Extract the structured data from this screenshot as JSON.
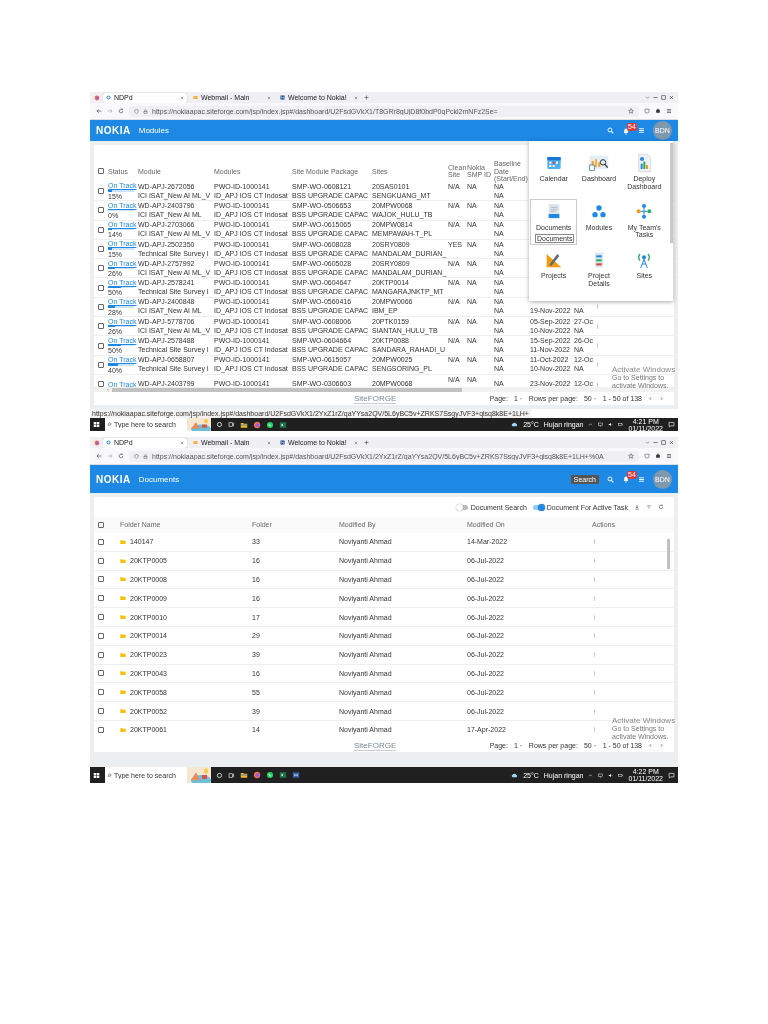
{
  "screenshots": [
    {
      "kind": "modules",
      "browser_tabs": [
        {
          "title": "NDPd",
          "selected": true
        },
        {
          "title": "Webmail - Main",
          "selected": false
        },
        {
          "title": "Welcome to Nokia!",
          "selected": false
        }
      ],
      "url": "https://nokiaapac.siteforge.com/jsp/index.jsp#/dashboard/U2FsdGVkX1/T8GRr8gUjD8f0bdP0qPckl2mNFz2Se=",
      "header": {
        "logo": "NOKIA",
        "title": "Modules",
        "notification_count": "54",
        "avatar": "BDN"
      },
      "table": {
        "select_all": false,
        "columns": [
          "Status",
          "Module",
          "Modules",
          "Site Module Package",
          "Sites",
          "Clean Site",
          "Nokia SMP ID",
          "Baseline Date (Start/End)"
        ],
        "rows": [
          {
            "checked": false,
            "status": "On Track",
            "level": 0.15,
            "percent": "15%",
            "module": [
              "WD-APJ-2672056",
              "ICI ISAT_New AI ML_V"
            ],
            "modules": [
              "PWO-ID-1000141",
              "ID_APJ IOS CT Indosat"
            ],
            "package": [
              "SMP-WO-0608121",
              "BSS UPGRADE CAPAC"
            ],
            "sites": [
              "20SAS0101",
              "SENGKUANG_MT"
            ],
            "clean_site": "N/A",
            "smp_id": "NA",
            "baseline": [
              "NA",
              "NA"
            ]
          },
          {
            "checked": false,
            "status": "On Track",
            "level": 0.0,
            "percent": "0%",
            "module": [
              "WD-APJ-2403796",
              "ICI ISAT_New AI ML"
            ],
            "modules": [
              "PWO-ID-1000141",
              "ID_APJ IOS CT Indosat"
            ],
            "package": [
              "SMP-WO-0506653",
              "BSS UPGRADE CAPAC"
            ],
            "sites": [
              "20MPW0068",
              "WAJOK_HULU_TB"
            ],
            "clean_site": "N/A",
            "smp_id": "NA",
            "baseline": [
              "NA",
              "NA"
            ]
          },
          {
            "checked": false,
            "status": "On Track",
            "level": 0.14,
            "percent": "14%",
            "module": [
              "WD-APJ-2703066",
              "ICI ISAT_New AI ML_V"
            ],
            "modules": [
              "PWO-ID-1000141",
              "ID_APJ IOS CT Indosat"
            ],
            "package": [
              "SMP-WO-0615065",
              "BSS UPGRADE CAPAC"
            ],
            "sites": [
              "20MPW0814",
              "MEMPAWAH-T_PL"
            ],
            "clean_site": "N/A",
            "smp_id": "NA",
            "baseline": [
              "NA",
              "NA"
            ]
          },
          {
            "checked": false,
            "status": "On Track",
            "level": 0.15,
            "percent": "15%",
            "module": [
              "WD-APJ-2502350",
              "Technical Site Survey I"
            ],
            "modules": [
              "PWO-ID-1000141",
              "ID_APJ IOS CT Indosat"
            ],
            "package": [
              "SMP-WO-0608028",
              "BSS UPGRADE CAPAC"
            ],
            "sites": [
              "20SRY0809",
              "MANDALAM_DURIAN_"
            ],
            "clean_site": "YES",
            "smp_id": "NA",
            "baseline": [
              "NA",
              "NA"
            ]
          },
          {
            "checked": false,
            "status": "On Track",
            "level": 0.26,
            "percent": "26%",
            "module": [
              "WD-APJ-2757992",
              "ICI ISAT_New AI ML_V"
            ],
            "modules": [
              "PWO-ID-1000141",
              "ID_APJ IOS CT Indosat"
            ],
            "package": [
              "SMP-WO-0605028",
              "BSS UPGRADE CAPAC"
            ],
            "sites": [
              "20SRY0809",
              "MANDALAM_DURIAN_"
            ],
            "clean_site": "N/A",
            "smp_id": "NA",
            "baseline": [
              "NA",
              "NA"
            ]
          },
          {
            "checked": false,
            "status": "On Track",
            "level": 0.5,
            "percent": "50%",
            "module": [
              "WD-APJ-2578241",
              "Technical Site Survey I"
            ],
            "modules": [
              "PWO-ID-1000141",
              "ID_APJ IOS CT Indosat"
            ],
            "package": [
              "SMP-WO-0604647",
              "BSS UPGRADE CAPAC"
            ],
            "sites": [
              "20KTP0014",
              "MANGARAJNKTP_MT"
            ],
            "clean_site": "N/A",
            "smp_id": "NA",
            "baseline": [
              "NA",
              "NA"
            ]
          },
          {
            "checked": false,
            "status": "On Track",
            "level": 0.28,
            "percent": "28%",
            "module": [
              "WD-APJ-2400848",
              "ICI ISAT_New AI ML"
            ],
            "modules": [
              "PWO-ID-1000141",
              "ID_APJ IOS CT Indosat"
            ],
            "package": [
              "SMP-WO-0560416",
              "BSS UPGRADE CAPAC"
            ],
            "sites": [
              "20MPW0066",
              "IBM_EP"
            ],
            "clean_site": "N/A",
            "smp_id": "NA",
            "baseline": [
              "NA",
              "NA"
            ],
            "dates": {
              "end": "19-Nov-2022"
            },
            "column_11": {
              "bottom": "NA"
            }
          },
          {
            "checked": false,
            "status": "On Track",
            "level": 0.26,
            "percent": "26%",
            "module": [
              "WD-APJ-5778706",
              "ICI ISAT_New AI ML_V"
            ],
            "modules": [
              "PWO-ID-1000141",
              "ID_APJ IOS CT Indosat"
            ],
            "package": [
              "SMP-WO-0608006",
              "BSS UPGRADE CAPAC"
            ],
            "sites": [
              "20PTK0159",
              "SIANTAN_HULU_TB"
            ],
            "clean_site": "N/A",
            "smp_id": "NA",
            "baseline": [
              "NA",
              "NA"
            ],
            "dates": {
              "start": "05-Sep-2022",
              "end": "10-Nov-2022"
            },
            "column_11": {
              "top": "27-Oc",
              "bottom": "NA"
            }
          },
          {
            "checked": false,
            "status": "On Track",
            "level": 0.5,
            "percent": "50%",
            "module": [
              "WD-APJ-2578488",
              "Technical Site Survey I"
            ],
            "modules": [
              "PWO-ID-1000141",
              "ID_APJ IOS CT Indosat"
            ],
            "package": [
              "SMP-WO-0604664",
              "BSS UPGRADE CAPAC"
            ],
            "sites": [
              "20KTP0088",
              "SANDARA_RAHADI_U"
            ],
            "clean_site": "N/A",
            "smp_id": "NA",
            "baseline": [
              "NA",
              "NA"
            ],
            "dates": {
              "start": "15-Sep-2022",
              "end": "11-Nov-2022"
            },
            "column_11": {
              "top": "26-Oc",
              "bottom": "NA"
            }
          },
          {
            "checked": false,
            "status": "On Track",
            "level": 0.4,
            "percent": "40%",
            "module": [
              "WD-APJ-0658807",
              "Technical Site Survey I"
            ],
            "modules": [
              "PWO-ID-1000141",
              "ID_APJ IOS CT Indosat"
            ],
            "package": [
              "SMP-WO-0615057",
              "BSS UPGRADE CAPAC"
            ],
            "sites": [
              "20MPW0025",
              "SENGSORING_PL"
            ],
            "clean_site": "N/A",
            "smp_id": "NA",
            "baseline": [
              "NA",
              "NA"
            ],
            "dates": {
              "start": "11-Oct-2022",
              "end": "10-Nov-2022"
            },
            "column_11": {
              "top": "12-Oc",
              "bottom": "NA"
            }
          },
          {
            "checked": false,
            "status": "On Track",
            "module": [
              "WD-APJ-2403799"
            ],
            "modules": [
              "PWO-ID-1000141"
            ],
            "package": [
              "SMP-WO-0306603"
            ],
            "sites": [
              "20MPW0068"
            ],
            "clean_site": "N/A",
            "smp_id": "NA",
            "baseline": [
              "NA"
            ],
            "dates": {
              "start": "23-Nov-2022"
            },
            "column_11": {
              "top": "12-Oc"
            }
          }
        ]
      },
      "app_menu": [
        {
          "label": "Calendar",
          "selected": false
        },
        {
          "label": "Dashboard",
          "selected": false
        },
        {
          "label": "Deploy Dashboard",
          "selected": false
        },
        {
          "label": "Documents",
          "selected": true
        },
        {
          "label": "Modules",
          "selected": false
        },
        {
          "label": "My Team's Tasks",
          "selected": false
        },
        {
          "label": "Projects",
          "selected": false
        },
        {
          "label": "Project Details",
          "selected": false
        },
        {
          "label": "Sites",
          "selected": false
        }
      ],
      "menu_tooltip": "Documents",
      "footer": {
        "brand": "SiteFORGE",
        "page_label": "Page:",
        "page": "1",
        "rows_label": "Rows per page:",
        "rows": "50",
        "range": "1 - 50 of 138"
      },
      "activation": {
        "title": "Activate Windows",
        "subtitle": "Go to Settings to activate Windows."
      },
      "status_url": "https://nokiaapac.siteforge.com/jsp/index.jsp#/dashboard/U2FsdGVkX1/2YxZ1rZ/qaYYsa2QV/5L6yBC5v+ZRKS7SsgyJVF3+qlsq8k8E+1LH+",
      "taskbar": {
        "search_placeholder": "Type here to search",
        "temperature": "25°C",
        "weather": "Hujan ringan",
        "time": "4:21 PM",
        "date": "01/11/2022"
      }
    },
    {
      "kind": "documents",
      "browser_tabs": [
        {
          "title": "NDPd",
          "selected": true
        },
        {
          "title": "Webmail - Main",
          "selected": false
        },
        {
          "title": "Welcome to Nokia!",
          "selected": false
        }
      ],
      "url": "https://nokiaapac.siteforge.com/jsp/index.jsp#/dashboard/U2FsdGVkX1/2YxZ1rZ/qaYYsa2QV/5L6yBC5v+ZRKS7SsgyJVF3+qlsq8k8E+1LH+%0A",
      "header": {
        "logo": "NOKIA",
        "title": "Documents",
        "notification_count": "54",
        "avatar": "BDN",
        "search_tooltip": "Search"
      },
      "toggles": [
        {
          "label": "Document Search",
          "on": false
        },
        {
          "label": "Document For Active Task",
          "on": true
        }
      ],
      "table": {
        "select_all": false,
        "columns": [
          "Folder Name",
          "Folder",
          "Modified By",
          "Modified On",
          "Actions"
        ],
        "rows": [
          {
            "checked": false,
            "name": "140147",
            "folder": "33",
            "modified_by": "Noviyanti Ahmad",
            "modified_on": "14-Mar-2022"
          },
          {
            "checked": false,
            "name": "20KTP0005",
            "folder": "16",
            "modified_by": "Noviyanti Ahmad",
            "modified_on": "06-Jul-2022"
          },
          {
            "checked": false,
            "name": "20KTP0008",
            "folder": "16",
            "modified_by": "Noviyanti Ahmad",
            "modified_on": "06-Jul-2022"
          },
          {
            "checked": false,
            "name": "20KTP0009",
            "folder": "16",
            "modified_by": "Noviyanti Ahmad",
            "modified_on": "06-Jul-2022"
          },
          {
            "checked": false,
            "name": "20KTP0010",
            "folder": "17",
            "modified_by": "Noviyanti Ahmad",
            "modified_on": "06-Jul-2022"
          },
          {
            "checked": false,
            "name": "20KTP0014",
            "folder": "29",
            "modified_by": "Noviyanti Ahmad",
            "modified_on": "06-Jul-2022"
          },
          {
            "checked": false,
            "name": "20KTP0023",
            "folder": "39",
            "modified_by": "Noviyanti Ahmad",
            "modified_on": "06-Jul-2022"
          },
          {
            "checked": false,
            "name": "20KTP0043",
            "folder": "16",
            "modified_by": "Noviyanti Ahmad",
            "modified_on": "06-Jul-2022"
          },
          {
            "checked": false,
            "name": "20KTP0058",
            "folder": "55",
            "modified_by": "Noviyanti Ahmad",
            "modified_on": "06-Jul-2022"
          },
          {
            "checked": false,
            "name": "20KTP0052",
            "folder": "39",
            "modified_by": "Noviyanti Ahmad",
            "modified_on": "06-Jul-2022"
          },
          {
            "checked": false,
            "name": "20KTP0061",
            "folder": "14",
            "modified_by": "Noviyanti Ahmad",
            "modified_on": "17-Apr-2022"
          }
        ]
      },
      "footer": {
        "brand": "SiteFORGE",
        "page_label": "Page:",
        "page": "1",
        "rows_label": "Rows per page:",
        "rows": "50",
        "range": "1 - 50 of 138"
      },
      "activation": {
        "title": "Activate Windows",
        "subtitle": "Go to Settings to activate Windows."
      },
      "taskbar": {
        "search_placeholder": "Type here to search",
        "temperature": "25°C",
        "weather": "Hujan ringan",
        "time": "4:22 PM",
        "date": "01/11/2022"
      }
    }
  ]
}
